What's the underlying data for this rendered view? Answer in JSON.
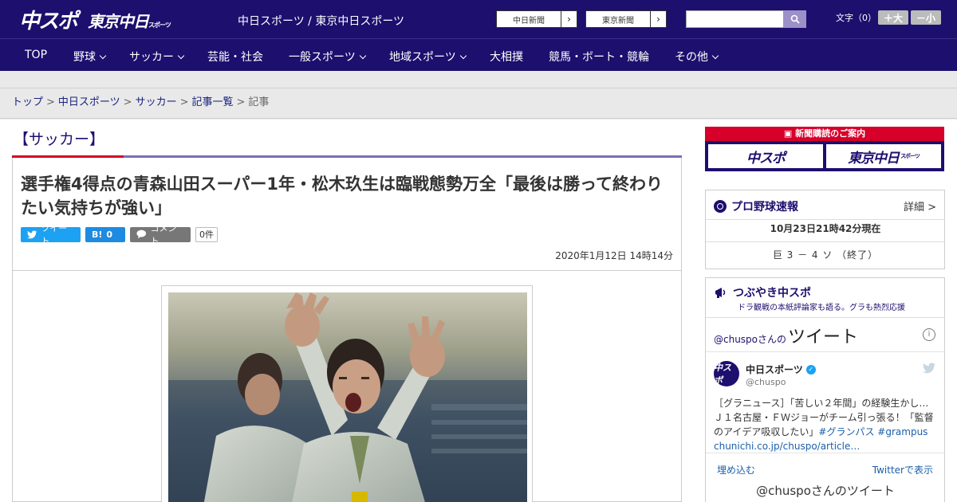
{
  "header": {
    "logo_main": "中スポ",
    "logo_tokyo": "東京中日",
    "logo_tokyo_small": "スポーツ",
    "site_links": "中日スポーツ / 東京中日スポーツ",
    "paper1": "中日新聞",
    "paper2": "東京新聞",
    "search_placeholder": "",
    "fontsize_label": "文字（0）",
    "font_up": "＋大",
    "font_down": "－小"
  },
  "nav": {
    "items": [
      "TOP",
      "野球",
      "サッカー",
      "芸能・社会",
      "一般スポーツ",
      "地域スポーツ",
      "大相撲",
      "競馬・ボート・競輪",
      "その他"
    ]
  },
  "breadcrumb": {
    "items": [
      "トップ",
      "中日スポーツ",
      "サッカー",
      "記事一覧"
    ],
    "current": "記事",
    "sep": ">"
  },
  "article": {
    "category": "【サッカー】",
    "headline": "選手権4得点の青森山田スーパー1年・松木玖生は臨戦態勢万全「最後は勝って終わりたい気持ちが強い」",
    "tweet_label": "ツイート",
    "hatena_label": "B!",
    "hatena_count": "0",
    "comment_label": "コメント",
    "comment_count": "0件",
    "date": "2020年1月12日 14時14分"
  },
  "sidebar": {
    "subscription_title": "新聞購読のご案内",
    "sub_btn1": "中スポ",
    "sub_btn2": "東京中日",
    "sub_btn2_small": "スポーツ",
    "baseball_title": "プロ野球速報",
    "baseball_more": "詳細 >",
    "baseball_time": "10月23日21時42分現在",
    "baseball_score": "巨 3 － 4 ソ （終了）",
    "tweets_title": "つぶやき中スポ",
    "tweets_sub": "ドラ観戦の本紙評論家も語る。グラも熱烈応援",
    "tweets_head_handle": "@chuspoさんの",
    "tweets_head_word": "ツイート",
    "tweet_name": "中日スポーツ",
    "tweet_handle": "@chuspo",
    "tweet_avatar": "中スポ",
    "tweet_text": "［グラニュース］「苦しい２年間」の経験生かし…Ｊ１名古屋・ＦＷジョーがチーム引っ張る！「監督のアイデア吸収したい」",
    "tweet_tag1": "#グランパス",
    "tweet_tag2": "#grampus",
    "tweet_link": "chunichi.co.jp/chuspo/article…",
    "embed": "埋め込む",
    "view_on_twitter": "Twitterで表示",
    "more_tweets": "@chuspoさんのツイート"
  },
  "colors": {
    "brand": "#1c0f6e",
    "accent_red": "#d6002a",
    "twitter": "#1da1f2"
  }
}
